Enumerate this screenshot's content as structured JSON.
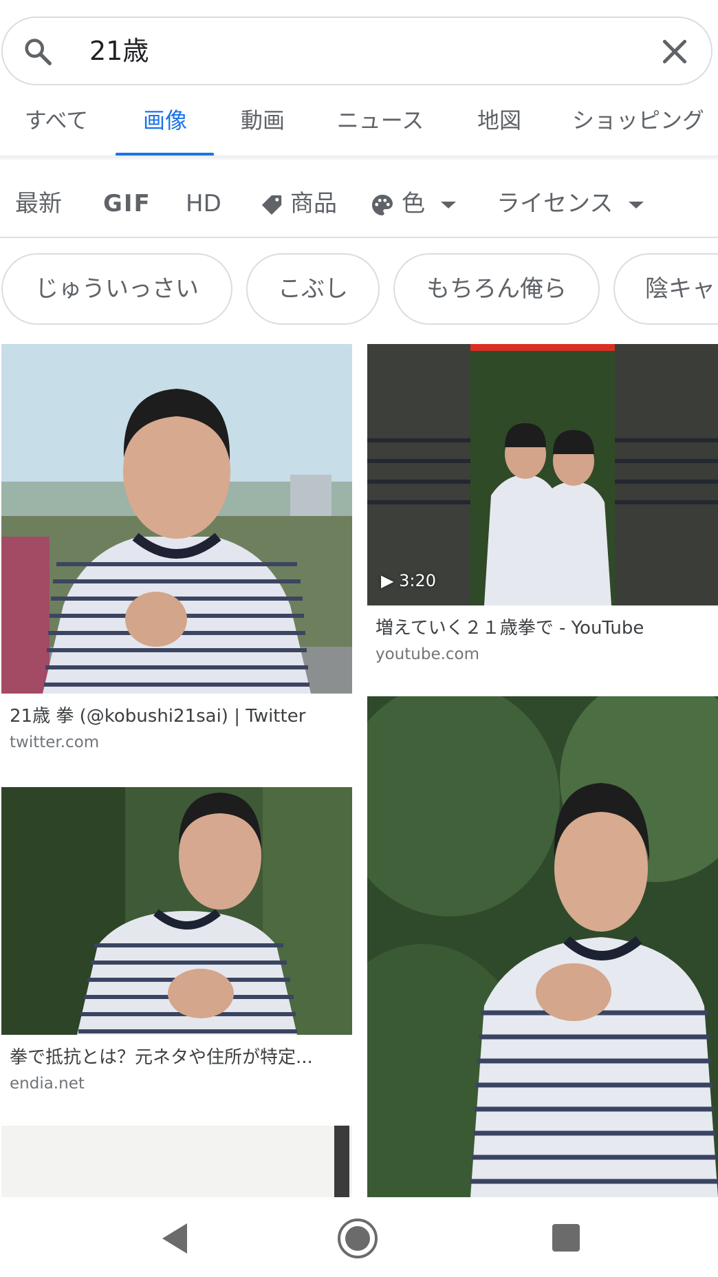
{
  "search": {
    "query": "21歳"
  },
  "tabs": [
    {
      "label": "すべて",
      "active": false
    },
    {
      "label": "画像",
      "active": true
    },
    {
      "label": "動画",
      "active": false
    },
    {
      "label": "ニュース",
      "active": false
    },
    {
      "label": "地図",
      "active": false
    },
    {
      "label": "ショッピング",
      "active": false
    }
  ],
  "filters": {
    "latest": "最新",
    "gif": "GIF",
    "hd": "HD",
    "products": "商品",
    "color": "色",
    "license": "ライセンス"
  },
  "chips": [
    "じゅういっさい",
    "こぶし",
    "もちろん俺ら",
    "陰キャ"
  ],
  "results": [
    {
      "title": "21歳 拳 (@kobushi21sai) | Twitter",
      "domain": "twitter.com"
    },
    {
      "title": "増えていく２１歳拳で - YouTube",
      "domain": "youtube.com",
      "duration": "3:20"
    },
    {
      "title": "拳で抵抗とは？元ネタや住所が特定...",
      "domain": "endia.net"
    }
  ],
  "colors": {
    "accent": "#1a73e8",
    "text_secondary": "#5f6368"
  }
}
